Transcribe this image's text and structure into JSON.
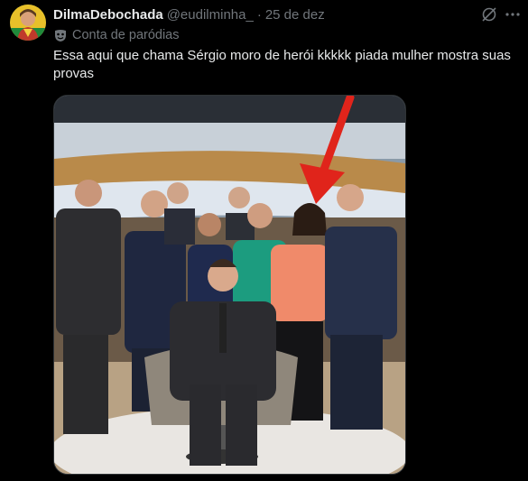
{
  "tweet": {
    "author_name": "DilmaDebochada",
    "handle": "@eudilminha_",
    "separator": "·",
    "date": "25 de dez",
    "parody_label": "Conta de paródias",
    "text": "Essa aqui que chama Sérgio moro de herói kkkkk piada mulher mostra suas provas"
  },
  "icons": {
    "grok": "grok-icon",
    "more": "more-icon",
    "parody": "mask-icon"
  },
  "colors": {
    "background": "#000000",
    "text": "#e7e9ea",
    "secondary": "#71767b",
    "arrow": "#e0241b"
  }
}
